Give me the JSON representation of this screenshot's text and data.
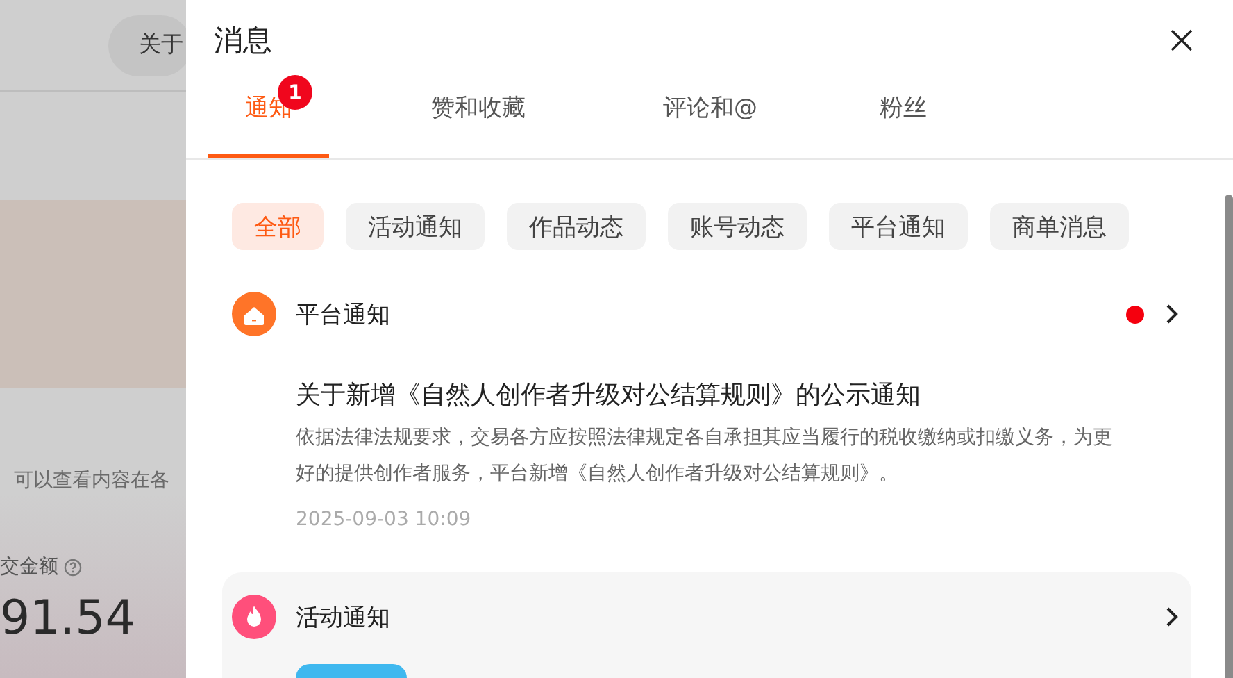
{
  "background_page": {
    "button": "关于",
    "hint": "可以查看内容在各",
    "metric_label": "交金额",
    "metric_value": "91.54"
  },
  "panel": {
    "title": "消息",
    "tabs": [
      {
        "label": "通知",
        "selected": true,
        "badge": "1"
      },
      {
        "label": "赞和收藏",
        "selected": false
      },
      {
        "label": "评论和@",
        "selected": false
      },
      {
        "label": "粉丝",
        "selected": false
      }
    ],
    "filters": [
      {
        "label": "全部",
        "selected": true
      },
      {
        "label": "活动通知",
        "selected": false
      },
      {
        "label": "作品动态",
        "selected": false
      },
      {
        "label": "账号动态",
        "selected": false
      },
      {
        "label": "平台通知",
        "selected": false
      },
      {
        "label": "商单消息",
        "selected": false
      }
    ],
    "notifications": [
      {
        "kind": "platform",
        "category": "平台通知",
        "unread": true,
        "hovered": false,
        "title": "关于新增《自然人创作者升级对公结算规则》的公示通知",
        "body": "依据法律法规要求，交易各方应按照法律规定各自承担其应当履行的税收缴纳或扣缴义务，为更好的提供创作者服务，平台新增《自然人创作者升级对公结算规则》。",
        "time": "2025-09-03 10:09"
      },
      {
        "kind": "activity",
        "category": "活动通知",
        "unread": false,
        "hovered": true,
        "tag": true
      }
    ]
  }
}
